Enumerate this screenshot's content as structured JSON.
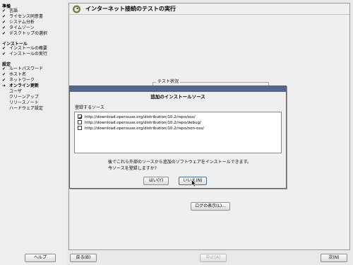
{
  "sidebar": {
    "sections": [
      {
        "title": "準備",
        "items": [
          {
            "mark": "✔",
            "label": "言語"
          },
          {
            "mark": "✔",
            "label": "ライセンス同意書"
          },
          {
            "mark": "✔",
            "label": "システム分析"
          },
          {
            "mark": "✔",
            "label": "タイムゾーン"
          },
          {
            "mark": "✔",
            "label": "デスクトップの選択"
          }
        ]
      },
      {
        "title": "インストール",
        "items": [
          {
            "mark": "✔",
            "label": "インストールの概要"
          },
          {
            "mark": "✔",
            "label": "インストールの実行"
          }
        ]
      },
      {
        "title": "設定",
        "items": [
          {
            "mark": "✔",
            "label": "ルートパスワード"
          },
          {
            "mark": "✔",
            "label": "ホスト名"
          },
          {
            "mark": "✔",
            "label": "ネットワーク"
          },
          {
            "mark": "➔",
            "label": "オンライン更新"
          },
          {
            "mark": "",
            "label": "ユーザ"
          },
          {
            "mark": "",
            "label": "クリーンアップ"
          },
          {
            "mark": "",
            "label": "リリースノート"
          },
          {
            "mark": "",
            "label": "ハードウェア設定"
          }
        ]
      }
    ]
  },
  "main": {
    "title": "インターネット接続のテストの実行",
    "title_icon": "opensuse-logo-icon",
    "status_group_label": "テスト状況",
    "show_log_label": "ログの表示(L)..."
  },
  "footer": {
    "help_label": "ヘルプ",
    "back_label": "戻る(B)",
    "abort_label": "中止(A)",
    "next_label": "次(N)"
  },
  "dialog": {
    "title": "追加のインストールソース",
    "sources_label": "登録するソース",
    "sources": [
      {
        "checked": true,
        "url": "http://download.opensuse.org/distribution/10.2/repo/oss/"
      },
      {
        "checked": false,
        "url": "http://download.opensuse.org/distribution/10.2/repo/debug/"
      },
      {
        "checked": false,
        "url": "http://download.opensuse.org/distribution/10.2/repo/non-oss/"
      }
    ],
    "message_line1": "後でこれら外部のソースから追加のソフトウェアをインストールできます。",
    "message_line2": "今ソースを登録しますか?",
    "yes_label": "はい(Y)",
    "no_label": "いいえ(N)"
  },
  "colors": {
    "dialog_titlebar": "#50688e",
    "accent_border": "#4a6da5",
    "background": "#e9e9e9"
  }
}
